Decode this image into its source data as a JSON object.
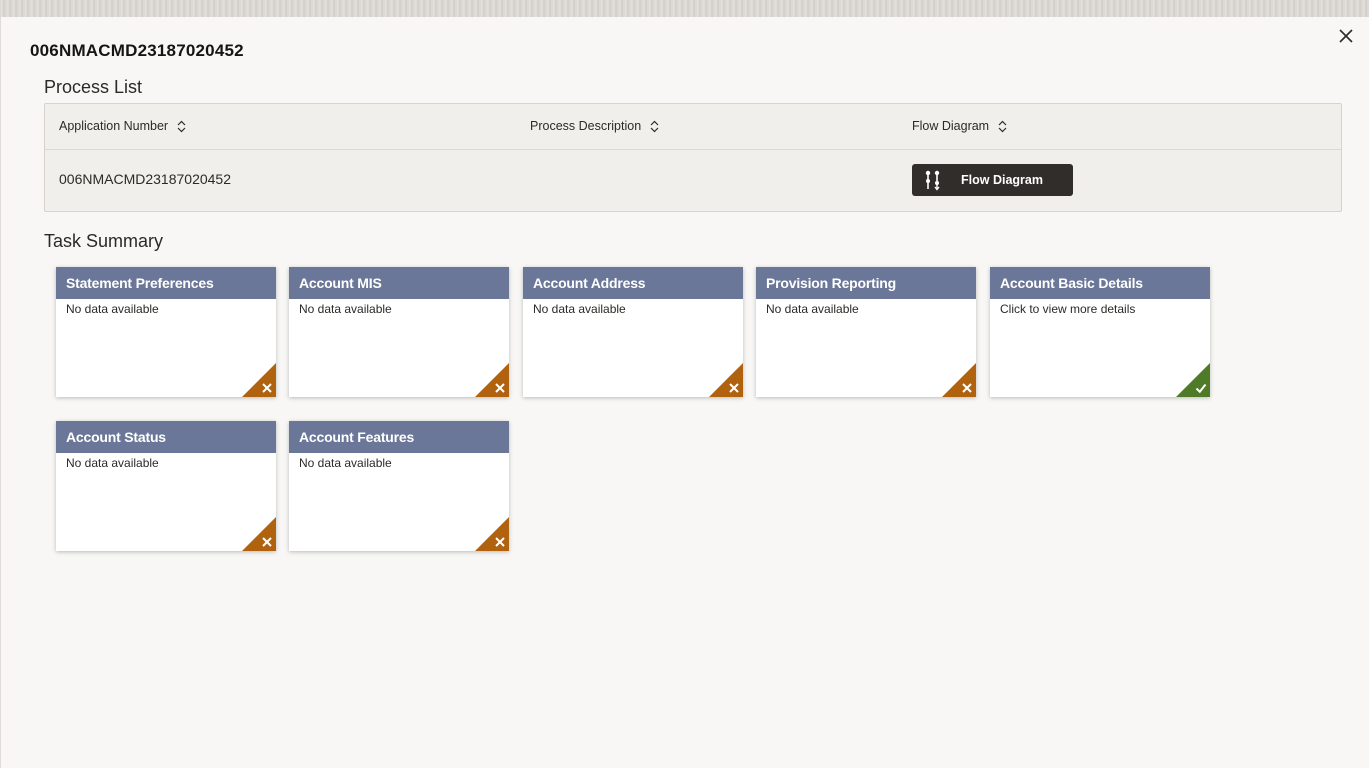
{
  "dialog": {
    "title": "006NMACMD23187020452"
  },
  "process_list": {
    "title": "Process List",
    "columns": [
      "Application Number",
      "Process Description",
      "Flow Diagram"
    ],
    "rows": [
      {
        "application_number": "006NMACMD23187020452",
        "process_description": "",
        "flow_button_label": "Flow Diagram"
      }
    ]
  },
  "task_summary": {
    "title": "Task Summary",
    "cards": [
      {
        "title": "Statement Preferences",
        "text": "No data available",
        "status": "incomplete"
      },
      {
        "title": "Account MIS",
        "text": "No data available",
        "status": "incomplete"
      },
      {
        "title": "Account Address",
        "text": "No data available",
        "status": "incomplete"
      },
      {
        "title": "Provision Reporting",
        "text": "No data available",
        "status": "incomplete"
      },
      {
        "title": "Account Basic Details",
        "text": "Click to view more details",
        "status": "complete"
      },
      {
        "title": "Account Status",
        "text": "No data available",
        "status": "incomplete"
      },
      {
        "title": "Account Features",
        "text": "No data available",
        "status": "incomplete"
      }
    ]
  },
  "colors": {
    "card_header": "#6b7798",
    "incomplete": "#b0620e",
    "complete": "#4f7a28",
    "button": "#312d2a"
  },
  "icons": {
    "close": "close-icon",
    "sort": "sort-icon",
    "flow": "flow-diagram-icon",
    "incomplete": "cross-icon",
    "complete": "check-icon"
  }
}
